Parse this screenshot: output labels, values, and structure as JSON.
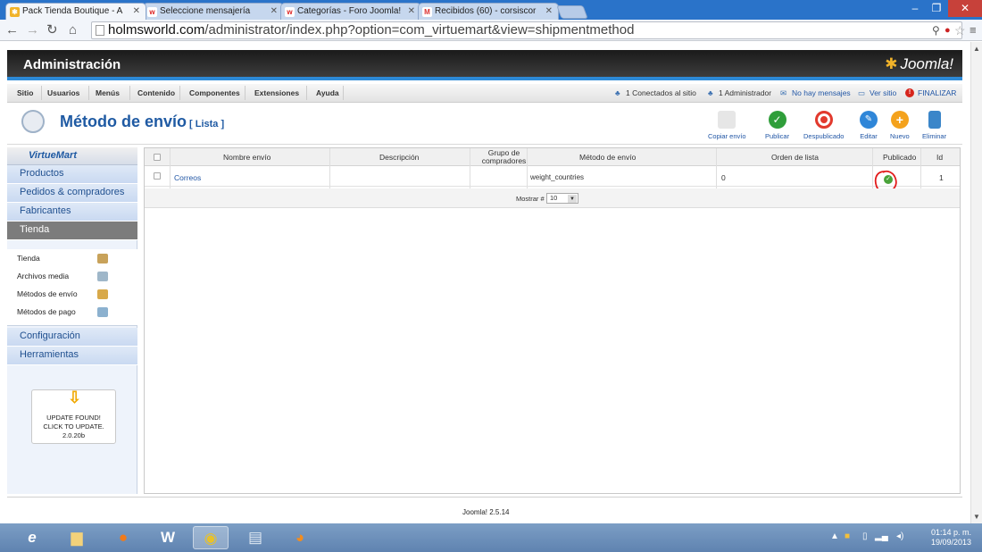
{
  "browser": {
    "tabs": [
      {
        "title": "Pack Tienda Boutique - A",
        "icon": "joomla-icon",
        "active": true
      },
      {
        "title": "Seleccione mensajería",
        "icon": "w-icon",
        "active": false
      },
      {
        "title": "Categorías - Foro Joomla!",
        "icon": "w-icon",
        "active": false
      },
      {
        "title": "Recibidos (60) - corsiscor",
        "icon": "gmail-icon",
        "active": false
      }
    ],
    "url_host": "holmsworld.com",
    "url_path": "/administrator/index.php?option=com_virtuemart&view=shipmentmethod"
  },
  "header": {
    "title": "Administración",
    "logo": "Joomla!"
  },
  "menu": {
    "items": [
      "Sitio",
      "Usuarios",
      "Menús",
      "Contenido",
      "Componentes",
      "Extensiones",
      "Ayuda"
    ],
    "status_online": "1 Conectados al sitio",
    "status_admin": "1 Administrador",
    "status_msgs": "No hay mensajes",
    "view_site": "Ver sitio",
    "logout": "FINALIZAR"
  },
  "toolbar": {
    "page_title": "Método de envío",
    "page_subtitle": "[ Lista ]",
    "buttons": [
      "Copiar envío",
      "Publicar",
      "Despublicado",
      "Editar",
      "Nuevo",
      "Eliminar"
    ]
  },
  "sidebar": {
    "logo": "VirtueMart",
    "sections": [
      "Productos",
      "Pedidos & compradores",
      "Fabricantes",
      "Tienda",
      "Configuración",
      "Herramientas"
    ],
    "tienda_items": [
      "Tienda",
      "Archivos media",
      "Métodos de envío",
      "Métodos de pago"
    ],
    "update": {
      "line1": "UPDATE FOUND!",
      "line2": "CLICK TO UPDATE.",
      "line3": "2.0.20b"
    }
  },
  "table": {
    "headers": [
      "Nombre envío",
      "Descripción",
      "Grupo de compradores",
      "Método de envío",
      "Orden de lista",
      "Publicado",
      "Id"
    ],
    "rows": [
      {
        "name": "Correos",
        "description": "",
        "group": "",
        "method": "weight_countries",
        "order": "0",
        "published": true,
        "id": "1"
      }
    ],
    "pager_label": "Mostrar #",
    "pager_value": "10"
  },
  "footer": {
    "version": "Joomla! 2.5.14"
  },
  "taskbar": {
    "time": "01:14 p. m.",
    "date": "19/09/2013"
  },
  "colors": {
    "accent": "#2d8ad7",
    "link": "#2156a5",
    "published": "#4aa33a",
    "taskbar": "#6b8fbc"
  }
}
